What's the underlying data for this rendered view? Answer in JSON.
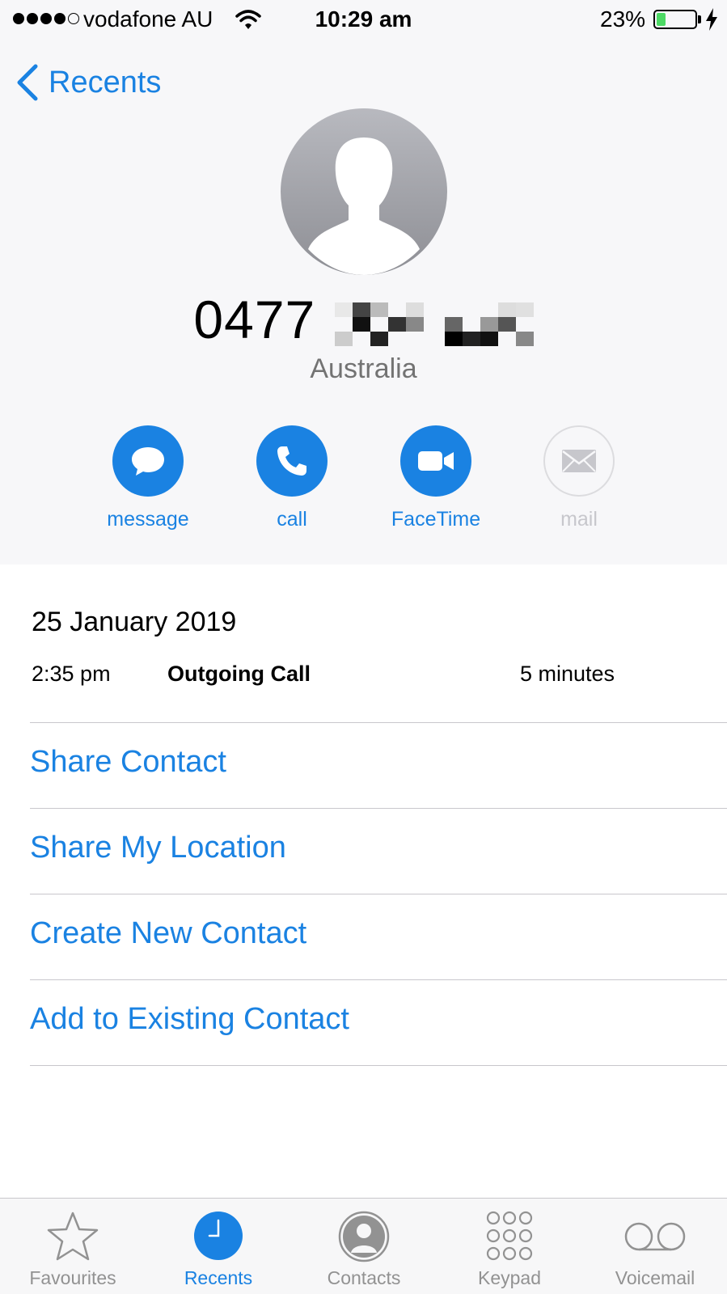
{
  "status_bar": {
    "carrier": "vodafone AU",
    "time": "10:29 am",
    "battery_percent": "23%",
    "battery_level": 0.23,
    "signal_bars_filled": 4,
    "signal_bars_total": 5
  },
  "nav": {
    "back_label": "Recents"
  },
  "contact": {
    "phone_number_visible": "0477",
    "region": "Australia"
  },
  "actions": [
    {
      "label": "message",
      "icon": "message-bubble-icon",
      "enabled": true
    },
    {
      "label": "call",
      "icon": "phone-icon",
      "enabled": true
    },
    {
      "label": "FaceTime",
      "icon": "video-camera-icon",
      "enabled": true
    },
    {
      "label": "mail",
      "icon": "envelope-icon",
      "enabled": false
    }
  ],
  "recent": {
    "date": "25 January 2019",
    "calls": [
      {
        "time": "2:35 pm",
        "type": "Outgoing Call",
        "duration": "5 minutes"
      }
    ]
  },
  "options": [
    "Share Contact",
    "Share My Location",
    "Create New Contact",
    "Add to Existing Contact"
  ],
  "tab_bar": {
    "active": "Recents",
    "tabs": [
      {
        "label": "Favourites",
        "icon": "star-icon"
      },
      {
        "label": "Recents",
        "icon": "clock-icon"
      },
      {
        "label": "Contacts",
        "icon": "person-circle-icon"
      },
      {
        "label": "Keypad",
        "icon": "keypad-icon"
      },
      {
        "label": "Voicemail",
        "icon": "voicemail-icon"
      }
    ]
  },
  "colors": {
    "accent": "#1a82e2",
    "header_bg": "#f7f7f9",
    "battery_green": "#4cd964",
    "inactive_gray": "#929292"
  }
}
